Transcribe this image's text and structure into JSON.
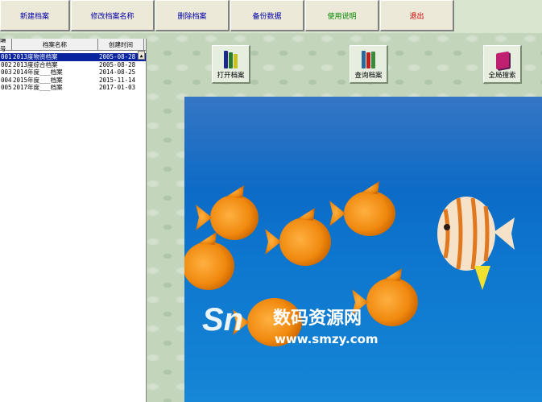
{
  "toolbar": {
    "buttons": [
      {
        "label": "新建档案",
        "color": "#0000aa"
      },
      {
        "label": "修改档案名称",
        "color": "#0000aa"
      },
      {
        "label": "删除档案",
        "color": "#0000aa"
      },
      {
        "label": "备份数据",
        "color": "#0000aa"
      },
      {
        "label": "使用说明",
        "color": "#008800"
      },
      {
        "label": "退出",
        "color": "#cc0000"
      }
    ]
  },
  "table": {
    "headers": [
      "编号",
      "档案名称",
      "创建时间"
    ],
    "rows": [
      [
        "001",
        "2013度物资档案",
        "2005-08-28"
      ],
      [
        "002",
        "2013度综合档案",
        "2005-08-28"
      ],
      [
        "003",
        "2014年度___档案",
        "2014-08-25"
      ],
      [
        "004",
        "2015年度___档案",
        "2015-11-14"
      ],
      [
        "005",
        "2017年度___档案",
        "2017-01-03"
      ]
    ],
    "selected_row": 0
  },
  "actions": {
    "open": "打开档案",
    "query": "查询档案",
    "search_all": "全局搜索"
  },
  "watermark": {
    "text_cn": "数码资源网",
    "url": "www.smzy.com"
  }
}
